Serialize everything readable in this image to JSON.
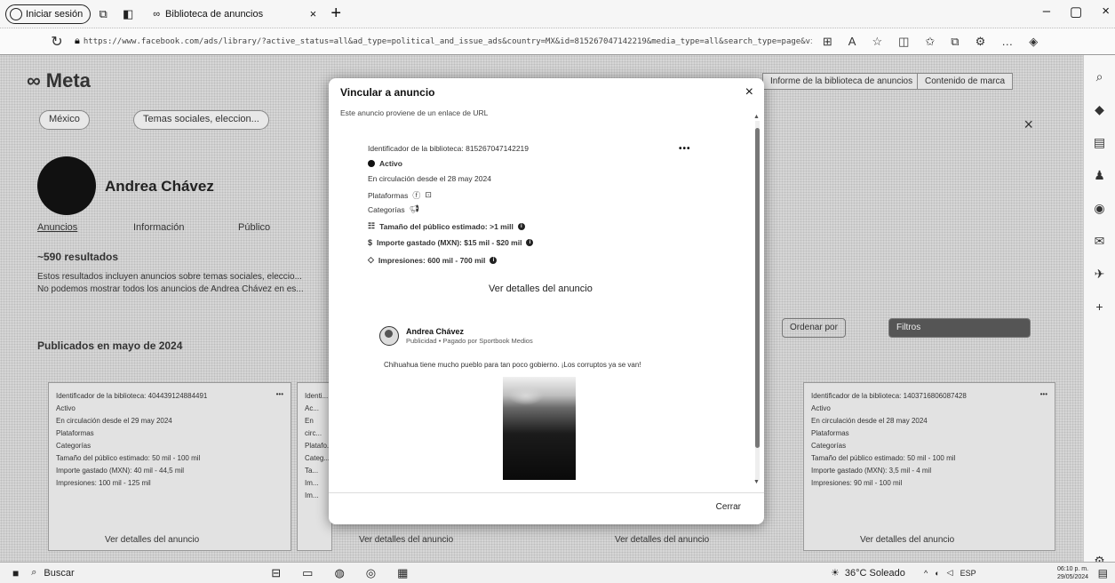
{
  "browser": {
    "signin_label": "Iniciar sesión",
    "tab_title": "Biblioteca de anuncios",
    "tab_close": "×",
    "new_tab": "+",
    "url": "https://www.facebook.com/ads/library/?active_status=all&ad_type=political_and_issue_ads&country=MX&id=815267047142219&media_type=all&search_type=page&view_all_page_id=112..."
  },
  "window_controls": {
    "minimize": "–",
    "maximize": "▢",
    "close": "×"
  },
  "background_page": {
    "logo": "Meta",
    "filters": [
      "México",
      "Temas sociales, eleccion..."
    ],
    "topright_links": [
      "Informe de la biblioteca de anuncios",
      "Contenido de marca"
    ],
    "advertiser_name": "Andrea Chávez",
    "tabs": [
      "Anuncios",
      "Información",
      "Público"
    ],
    "results": "~590 resultados",
    "notice_lines": [
      "Estos resultados incluyen anuncios sobre temas sociales, eleccio...",
      "No podemos mostrar todos los anuncios de Andrea Chávez en es..."
    ],
    "published_heading": "Publicados en mayo de 2024",
    "sort_options": [
      "Ordenar por",
      "Filtros"
    ],
    "cards": [
      {
        "lines": [
          "Identificador de la biblioteca: 404439124884491",
          "Activo",
          "En circulación desde el 29 may 2024",
          "Plataformas",
          "Categorías",
          "Tamaño del público estimado: 50 mil - 100 mil",
          "Importe gastado (MXN): 40 mil - 44,5 mil",
          "Impresiones: 100 mil - 125 mil"
        ],
        "button": "Ver detalles del anuncio"
      },
      {
        "lines": [
          "Identi...",
          "Ac...",
          "En circ...",
          "Platafo...",
          "Categ...",
          "Ta...",
          "Im...",
          "Im..."
        ],
        "button": "Ver detalles del anuncio"
      },
      {
        "lines": [
          "Identificador de la biblioteca: 1403716806087428",
          "Activo",
          "En circulación desde el 28 may 2024",
          "Plataformas",
          "Categorías",
          "Tamaño del público estimado: 50 mil - 100 mil",
          "Importe gastado (MXN): 3,5 mil - 4 mil",
          "Impresiones: 90 mil - 100 mil"
        ],
        "button": "Ver detalles del anuncio"
      }
    ]
  },
  "modal": {
    "title": "Vincular a anuncio",
    "close": "×",
    "subtitle": "Este anuncio proviene de un enlace de URL",
    "library_id": "Identificador de la biblioteca: 815267047142219",
    "more": "•••",
    "status": "Activo",
    "since": "En circulación desde el 28 may 2024",
    "platforms_label": "Plataformas",
    "categories_label": "Categorías",
    "audience": "Tamaño del público estimado: >1 mill",
    "spend": "Importe gastado (MXN): $15 mil - $20 mil",
    "impressions": "Impresiones: 600 mil - 700 mil",
    "details_button": "Ver detalles del anuncio",
    "advertiser": "Andrea Chávez",
    "sponsor": "Publicidad • Pagado por Sportbook Medios",
    "ad_text": "Chihuahua tiene mucho pueblo para tan poco gobierno. ¡Los corruptos ya se van!",
    "footer_close": "Cerrar"
  },
  "taskbar": {
    "search": "Buscar",
    "weather": "36°C Soleado",
    "lang": "ESP",
    "time": "06:10 p. m.",
    "date": "29/05/2024"
  }
}
